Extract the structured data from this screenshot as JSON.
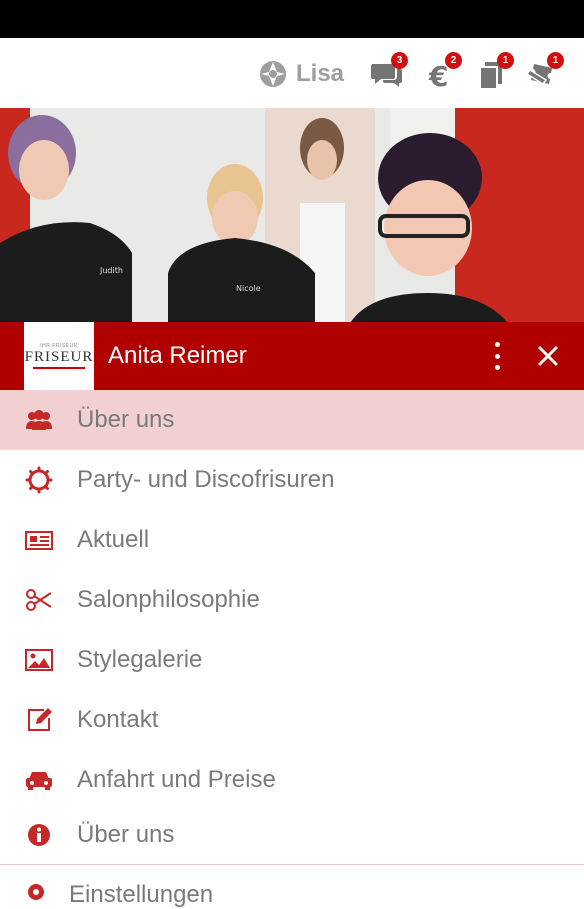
{
  "topbar": {
    "brand_name": "Lisa",
    "badges": {
      "messages": "3",
      "payments": "2",
      "documents": "1",
      "coupons": "1"
    }
  },
  "profile": {
    "name": "Anita Reimer"
  },
  "logo": {
    "small_text": "IHR FRISEUR",
    "main_text": "FRISEUR"
  },
  "hero": {
    "shirt_names": [
      "Judith",
      "Nicole"
    ]
  },
  "menu": {
    "items": [
      {
        "label": "Über uns",
        "icon": "users-icon",
        "active": true
      },
      {
        "label": "Party- und Discofrisuren",
        "icon": "gear-icon",
        "active": false
      },
      {
        "label": "Aktuell",
        "icon": "newspaper-icon",
        "active": false
      },
      {
        "label": "Salonphilosophie",
        "icon": "scissors-icon",
        "active": false
      },
      {
        "label": "Stylegalerie",
        "icon": "image-icon",
        "active": false
      },
      {
        "label": "Kontakt",
        "icon": "edit-icon",
        "active": false
      },
      {
        "label": "Anfahrt und Preise",
        "icon": "car-icon",
        "active": false
      },
      {
        "label": "Über uns",
        "icon": "info-icon",
        "active": false
      }
    ]
  },
  "settings": {
    "label": "Einstellungen"
  },
  "colors": {
    "accent": "#b10000",
    "icon": "#c62828",
    "active_bg": "#f2d0d1",
    "text": "#7a7a7a"
  }
}
